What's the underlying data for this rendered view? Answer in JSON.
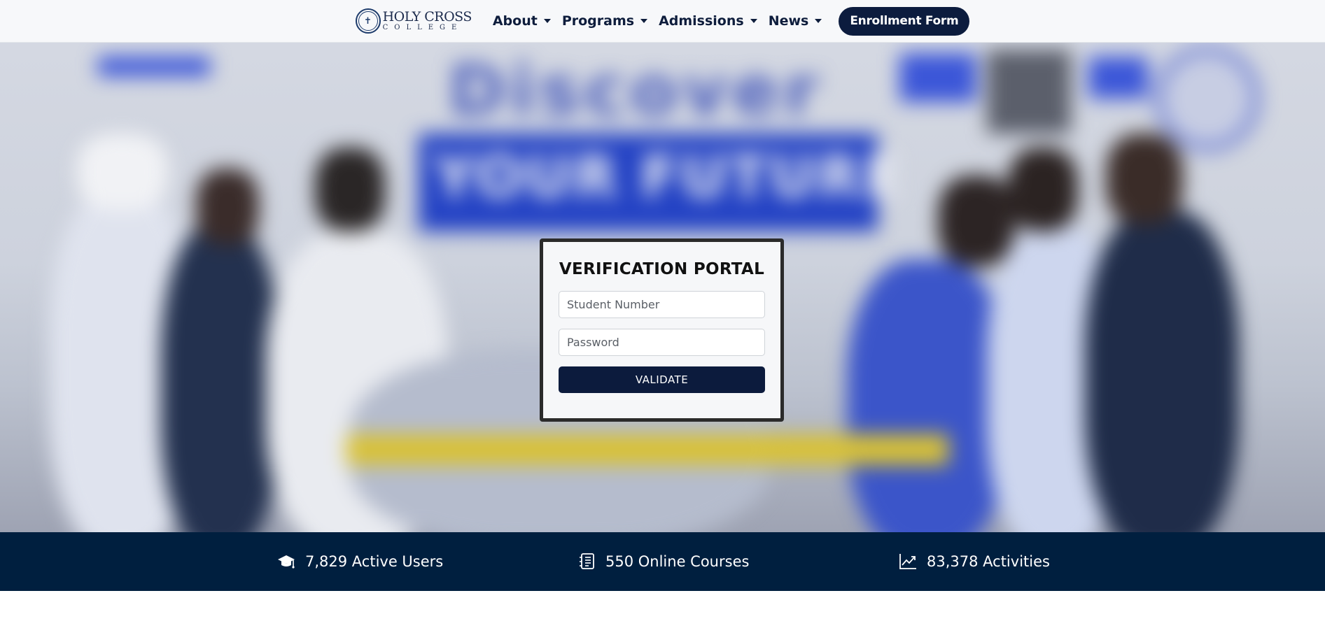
{
  "navbar": {
    "brand_name": "HOLY CROSS",
    "brand_sub": "COLLEGE",
    "links": [
      "About",
      "Programs",
      "Admissions",
      "News"
    ],
    "enroll_label": "Enrollment Form",
    "accent_color": "#0c1c3e"
  },
  "hero": {
    "background_text": "Discover",
    "band_text": "YOUR FUTURE"
  },
  "portal": {
    "title": "VERIFICATION PORTAL",
    "student_number_placeholder": "Student Number",
    "student_number_value": "",
    "password_placeholder": "Password",
    "password_value": "",
    "validate_label": "VALIDATE"
  },
  "stats": {
    "background": "#001f3f",
    "items": [
      {
        "icon": "graduation-cap-icon",
        "text": "7,829 Active Users"
      },
      {
        "icon": "course-list-icon",
        "text": "550 Online Courses"
      },
      {
        "icon": "trend-chart-icon",
        "text": "83,378 Activities"
      }
    ]
  }
}
